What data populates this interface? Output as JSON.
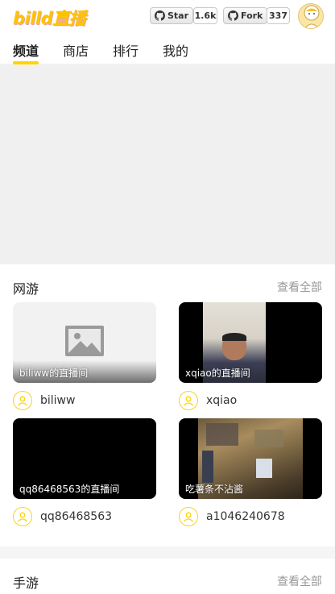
{
  "header": {
    "logo": "billd直播",
    "star_label": "Star",
    "star_count": "1.6k",
    "fork_label": "Fork",
    "fork_count": "337"
  },
  "tabs": [
    {
      "label": "频道",
      "active": true
    },
    {
      "label": "商店",
      "active": false
    },
    {
      "label": "排行",
      "active": false
    },
    {
      "label": "我的",
      "active": false
    }
  ],
  "sections": [
    {
      "title": "网游",
      "more": "查看全部",
      "rooms": [
        {
          "title": "biliww的直播间",
          "user": "biliww"
        },
        {
          "title": "xqiao的直播间",
          "user": "xqiao"
        },
        {
          "title": "qq86468563的直播间",
          "user": "qq86468563"
        },
        {
          "title": "吃薯条不沾酱",
          "user": "a1046240678"
        }
      ]
    },
    {
      "title": "手游",
      "more": "查看全部"
    }
  ],
  "colors": {
    "accent": "#ffd400",
    "logo": "#ffc400"
  }
}
